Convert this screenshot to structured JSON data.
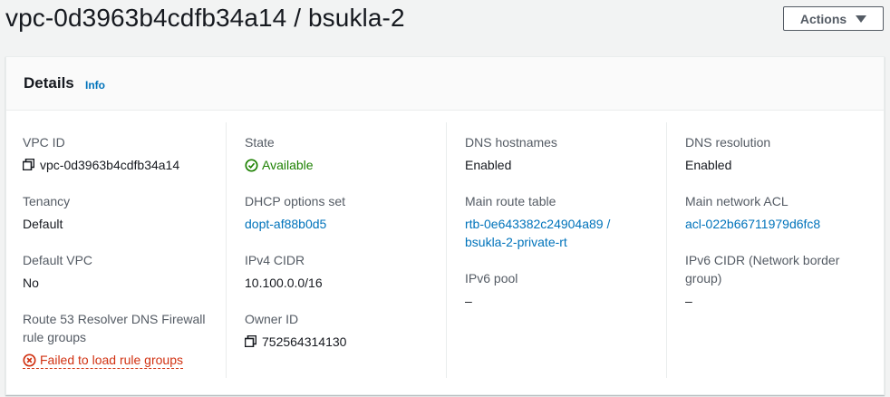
{
  "header": {
    "title": "vpc-0d3963b4cdfb34a14 / bsukla-2",
    "actions_label": "Actions"
  },
  "details": {
    "title": "Details",
    "info_label": "Info",
    "columns": [
      [
        {
          "label": "VPC ID",
          "value": "vpc-0d3963b4cdfb34a14",
          "icon": "copy-icon"
        },
        {
          "label": "Tenancy",
          "value": "Default"
        },
        {
          "label": "Default VPC",
          "value": "No"
        },
        {
          "label": "Route 53 Resolver DNS Firewall rule groups",
          "value": "Failed to load rule groups",
          "status": "error"
        }
      ],
      [
        {
          "label": "State",
          "value": "Available",
          "status": "success"
        },
        {
          "label": "DHCP options set",
          "value": "dopt-af88b0d5",
          "link": true
        },
        {
          "label": "IPv4 CIDR",
          "value": "10.100.0.0/16"
        },
        {
          "label": "Owner ID",
          "value": "752564314130",
          "icon": "copy-icon"
        }
      ],
      [
        {
          "label": "DNS hostnames",
          "value": "Enabled"
        },
        {
          "label": "Main route table",
          "value": "rtb-0e643382c24904a89 / bsukla-2-private-rt",
          "link": true
        },
        {
          "label": "IPv6 pool",
          "value": "–"
        }
      ],
      [
        {
          "label": "DNS resolution",
          "value": "Enabled"
        },
        {
          "label": "Main network ACL",
          "value": "acl-022b66711979d6fc8",
          "link": true
        },
        {
          "label": "IPv6 CIDR (Network border group)",
          "value": "–"
        }
      ]
    ]
  },
  "colors": {
    "link": "#0073bb",
    "success": "#1d8102",
    "error": "#d13212"
  }
}
